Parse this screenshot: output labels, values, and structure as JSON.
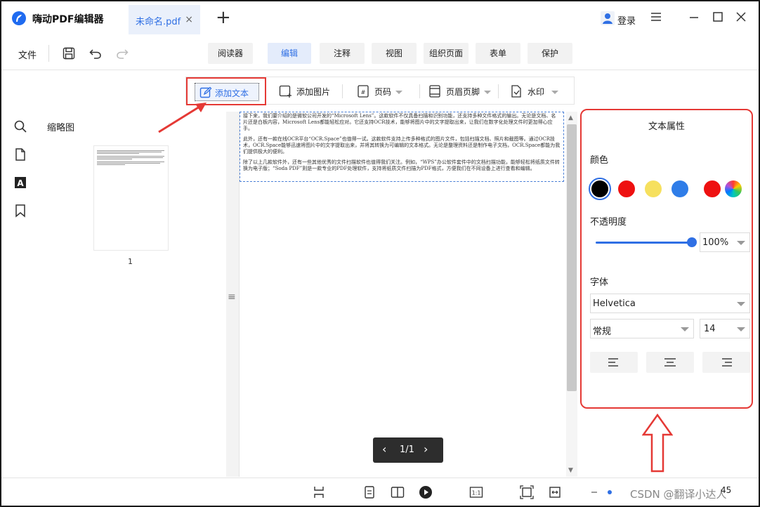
{
  "app": {
    "name": "嗨动PDF编辑器"
  },
  "tab": {
    "label": "未命名.pdf",
    "close": "×",
    "new_tab": "+"
  },
  "account": {
    "login_label": "登录"
  },
  "toolbar": {
    "file_label": "文件",
    "mode_tabs": [
      "阅读器",
      "编辑",
      "注释",
      "视图",
      "组织页面",
      "表单",
      "保护"
    ],
    "active_mode": "编辑"
  },
  "edit_bar": {
    "add_text": "添加文本",
    "add_image": "添加图片",
    "page_number": "页码",
    "header_footer": "页眉页脚",
    "watermark": "水印"
  },
  "thumbnails": {
    "title": "缩略图",
    "page_number": "1"
  },
  "document": {
    "paragraphs": [
      "接下来，我们要介绍的是微软公司开发的“Microsoft Lens”。这款软件不仅具备扫描和识别功能，还支持多种文件格式的输出。无论是文档、名片还是白板内容，Microsoft Lens都能轻松应对。它还支持OCR技术，能够将图片中的文字提取出来，让我们在数字化处理文件时更加得心应手。",
      "此外，还有一款在线OCR平台“OCR.Space”也值得一试。这款软件支持上传多种格式的图片文件，包括扫描文档、照片和截图等。通过OCR技术，OCR.Space能够迅速将图片中的文字提取出来，并将其转换为可编辑的文本格式。无论是整理资料还是制作电子文档，OCR.Space都能为我们提供极大的便利。",
      "除了以上几款软件外，还有一些其他优秀的文件扫描软件也值得我们关注。例如，“WPS”办公软件套件中的文档扫描功能，能够轻松将纸质文件转换为电子版；“Soda PDF”则是一款专业的PDF处理软件，支持将纸质文件扫描为PDF格式，方便我们在不同设备上进行查看和编辑。"
    ]
  },
  "pager": {
    "label": "1/1",
    "prev": "‹",
    "next": "›"
  },
  "properties": {
    "title": "文本属性",
    "color_label": "颜色",
    "colors": [
      "#000000",
      "#ee1111",
      "#f6e05e",
      "#2f7de8",
      "#ee1111"
    ],
    "selected_color": "#000000",
    "opacity_label": "不透明度",
    "opacity_value": "100%",
    "opacity_level": 1.0,
    "font_label": "字体",
    "font_family": "Helvetica",
    "font_style": "常规",
    "font_size": "14"
  },
  "status": {
    "watermark_text": "CSDN @翻译小达人",
    "zoom": "45"
  }
}
